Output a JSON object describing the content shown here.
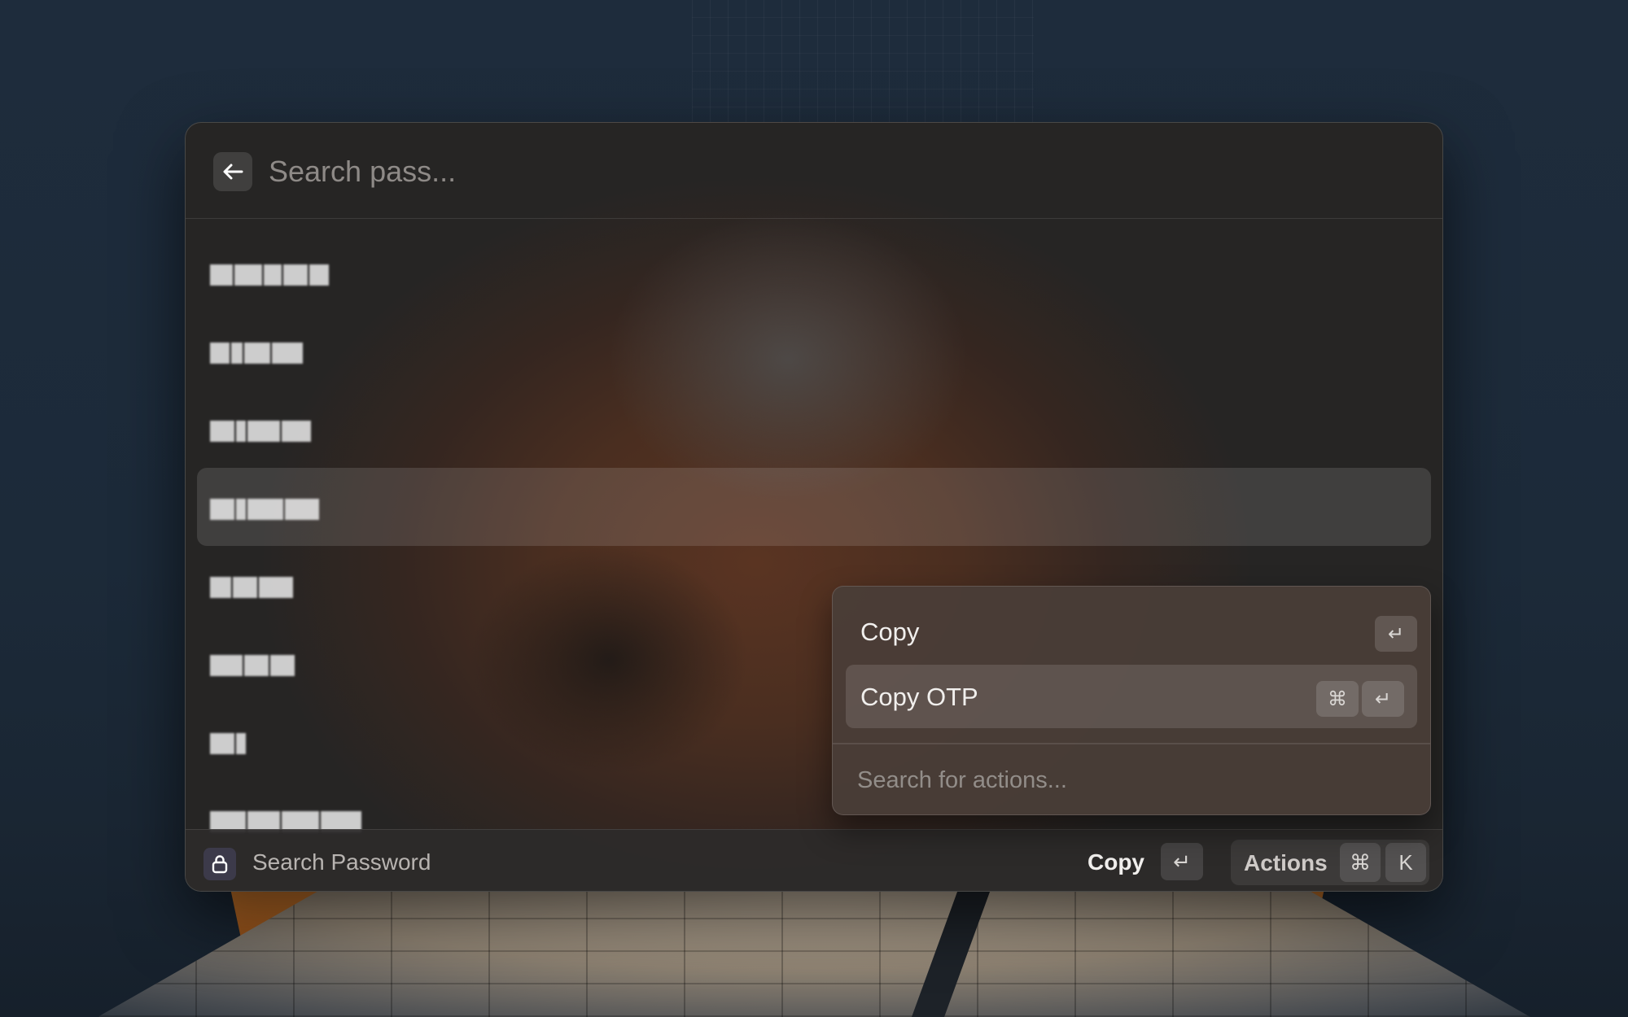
{
  "search": {
    "placeholder": "Search pass..."
  },
  "list": {
    "items": [
      {
        "label_hidden": true
      },
      {
        "label_hidden": true
      },
      {
        "label_hidden": true
      },
      {
        "label_hidden": true,
        "selected": true
      },
      {
        "label_hidden": true
      },
      {
        "label_hidden": true
      },
      {
        "label_hidden": true
      },
      {
        "label_hidden": true
      }
    ]
  },
  "actions_panel": {
    "items": [
      {
        "label": "Copy",
        "shortcut": [
          "↵"
        ]
      },
      {
        "label": "Copy OTP",
        "shortcut": [
          "⌘",
          "↵"
        ]
      }
    ],
    "search_placeholder": "Search for actions..."
  },
  "footer": {
    "title": "Search Password",
    "icon": "lock-icon",
    "primary_action": "Copy",
    "primary_shortcut": "↵",
    "actions_label": "Actions",
    "actions_shortcut": [
      "⌘",
      "K"
    ]
  }
}
